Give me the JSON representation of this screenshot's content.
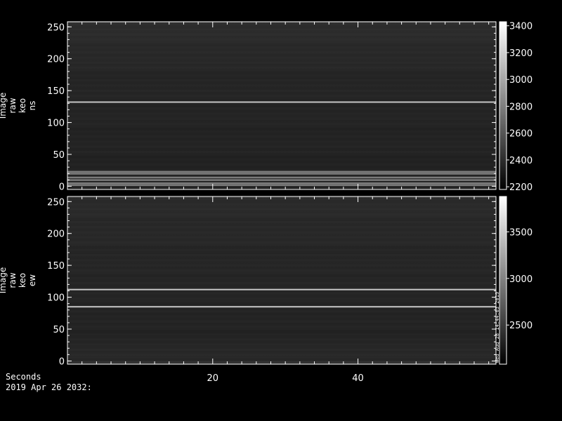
{
  "footer": {
    "xlabel": "Seconds",
    "date": "2019 Apr 26 2032:"
  },
  "colors": {
    "background": "#000000",
    "foreground": "#ffffff"
  },
  "chart_data": [
    {
      "type": "heatmap",
      "ylabel_lines": [
        "Image",
        "raw",
        "keo",
        "ns"
      ],
      "x_ticks": [
        20,
        40
      ],
      "xlim": [
        0,
        59
      ],
      "y_ticks": [
        0,
        50,
        100,
        150,
        200,
        250
      ],
      "ylim": [
        -5,
        258
      ],
      "colorbar_ticks": [
        2200,
        2400,
        2600,
        2800,
        3000,
        3200,
        3400
      ],
      "colorbar_range": [
        2180,
        3430
      ],
      "colormap": "grayscale",
      "bright_rows": [
        2,
        5,
        10,
        14,
        20,
        23,
        132
      ],
      "annotation": ""
    },
    {
      "type": "heatmap",
      "ylabel_lines": [
        "Image",
        "raw",
        "keo",
        "ew"
      ],
      "x_ticks": [
        20,
        40
      ],
      "xlim": [
        0,
        59
      ],
      "y_ticks": [
        0,
        50,
        100,
        150,
        200,
        250
      ],
      "ylim": [
        -5,
        258
      ],
      "colorbar_ticks": [
        2500,
        3000,
        3500
      ],
      "colorbar_range": [
        2080,
        3880
      ],
      "colormap": "grayscale",
      "bright_rows": [
        85,
        112
      ],
      "annotation": "Wed Aug 28 14:44:03 2019"
    }
  ]
}
